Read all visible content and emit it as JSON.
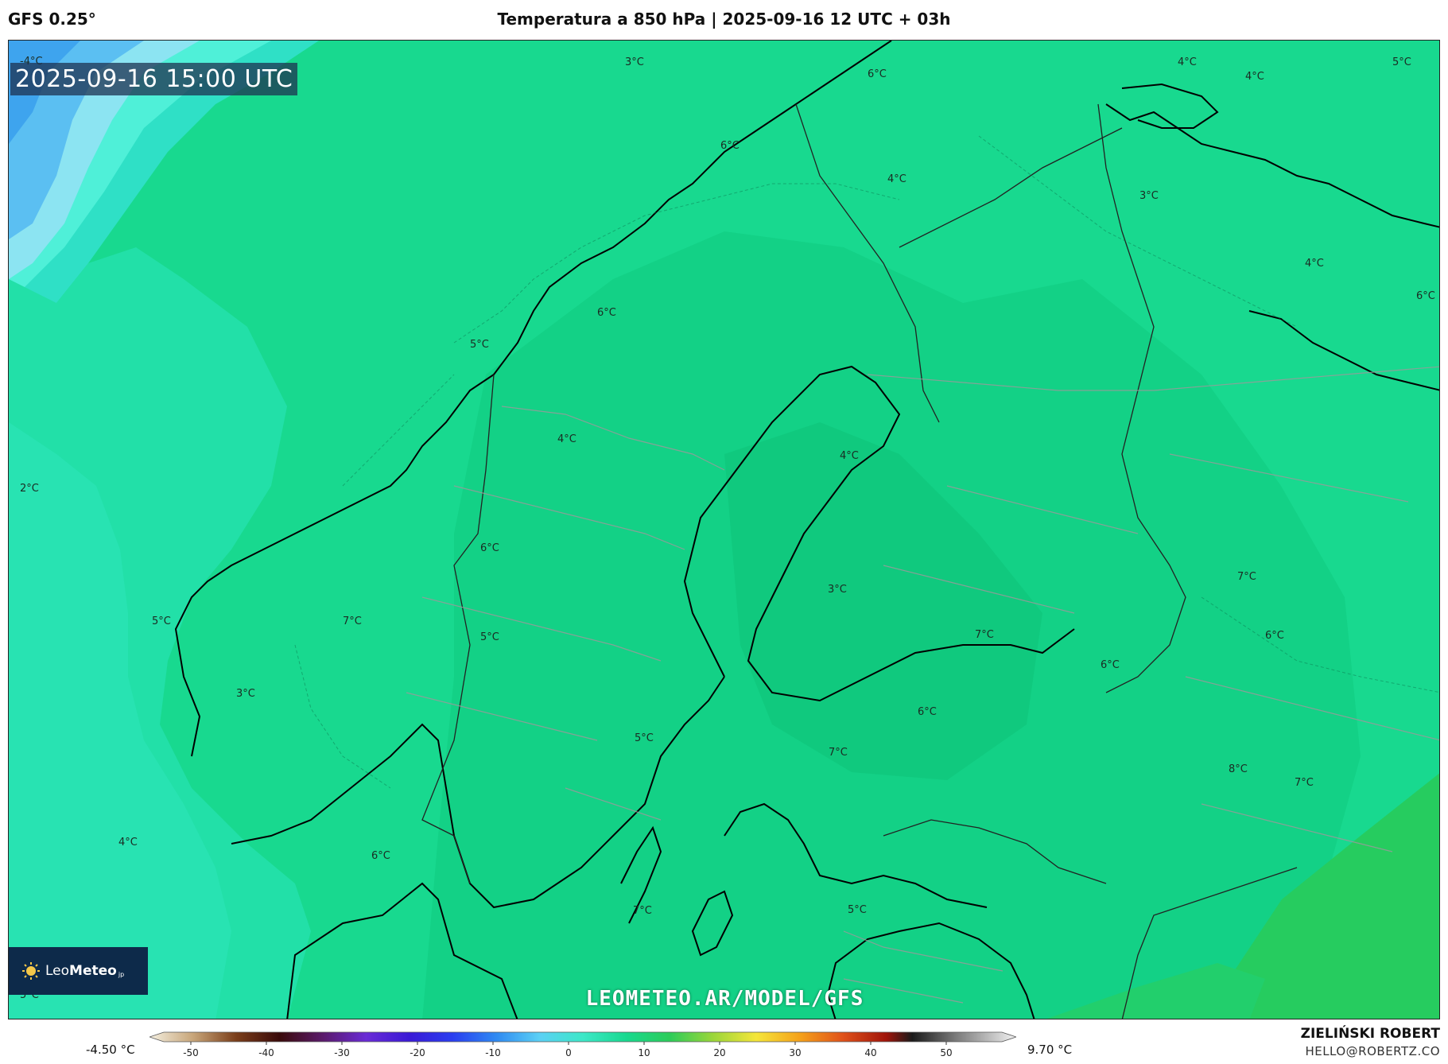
{
  "header": {
    "model": "GFS 0.25°",
    "title": "Temperatura a 850 hPa | 2025-09-16 12 UTC + 03h"
  },
  "map": {
    "timestamp": "2025-09-16 15:00 UTC",
    "watermark": "LEOMETEO.AR/MODEL/GFS",
    "logo": {
      "name_light": "Leo",
      "name_bold": "Meteo",
      "suffix": "jp"
    },
    "colors": {
      "ocean_cold": "#5bc8f5",
      "ocean_cool": "#3de8c8",
      "land_base": "#18d98f",
      "land_warm": "#2ccc5a",
      "coast": "#000000",
      "border": "#9a9a9a"
    },
    "temperature_labels": [
      {
        "text": "-4°C"
      },
      {
        "text": "3°C"
      },
      {
        "text": "6°C"
      },
      {
        "text": "4°C"
      },
      {
        "text": "4°C"
      },
      {
        "text": "5°C"
      },
      {
        "text": "6°C"
      },
      {
        "text": "4°C"
      },
      {
        "text": "3°C"
      },
      {
        "text": "4°C"
      },
      {
        "text": "6°C"
      },
      {
        "text": "6°C"
      },
      {
        "text": "5°C"
      },
      {
        "text": "4°C"
      },
      {
        "text": "4°C"
      },
      {
        "text": "2°C"
      },
      {
        "text": "6°C"
      },
      {
        "text": "3°C"
      },
      {
        "text": "7°C"
      },
      {
        "text": "5°C"
      },
      {
        "text": "7°C"
      },
      {
        "text": "5°C"
      },
      {
        "text": "6°C"
      },
      {
        "text": "7°C"
      },
      {
        "text": "6°C"
      },
      {
        "text": "3°C"
      },
      {
        "text": "6°C"
      },
      {
        "text": "5°C"
      },
      {
        "text": "7°C"
      },
      {
        "text": "8°C"
      },
      {
        "text": "7°C"
      },
      {
        "text": "4°C"
      },
      {
        "text": "6°C"
      },
      {
        "text": "7°C"
      },
      {
        "text": "5°C"
      },
      {
        "text": "5°C"
      }
    ]
  },
  "legend": {
    "min": "-4.50 °C",
    "max": "9.70 °C",
    "ticks": [
      "-50",
      "-40",
      "-30",
      "-20",
      "-10",
      "0",
      "10",
      "20",
      "30",
      "40",
      "50"
    ]
  },
  "footer": {
    "author": "ZIELIŃSKI ROBERT",
    "email": "HELLO@ROBERTZ.CO"
  }
}
